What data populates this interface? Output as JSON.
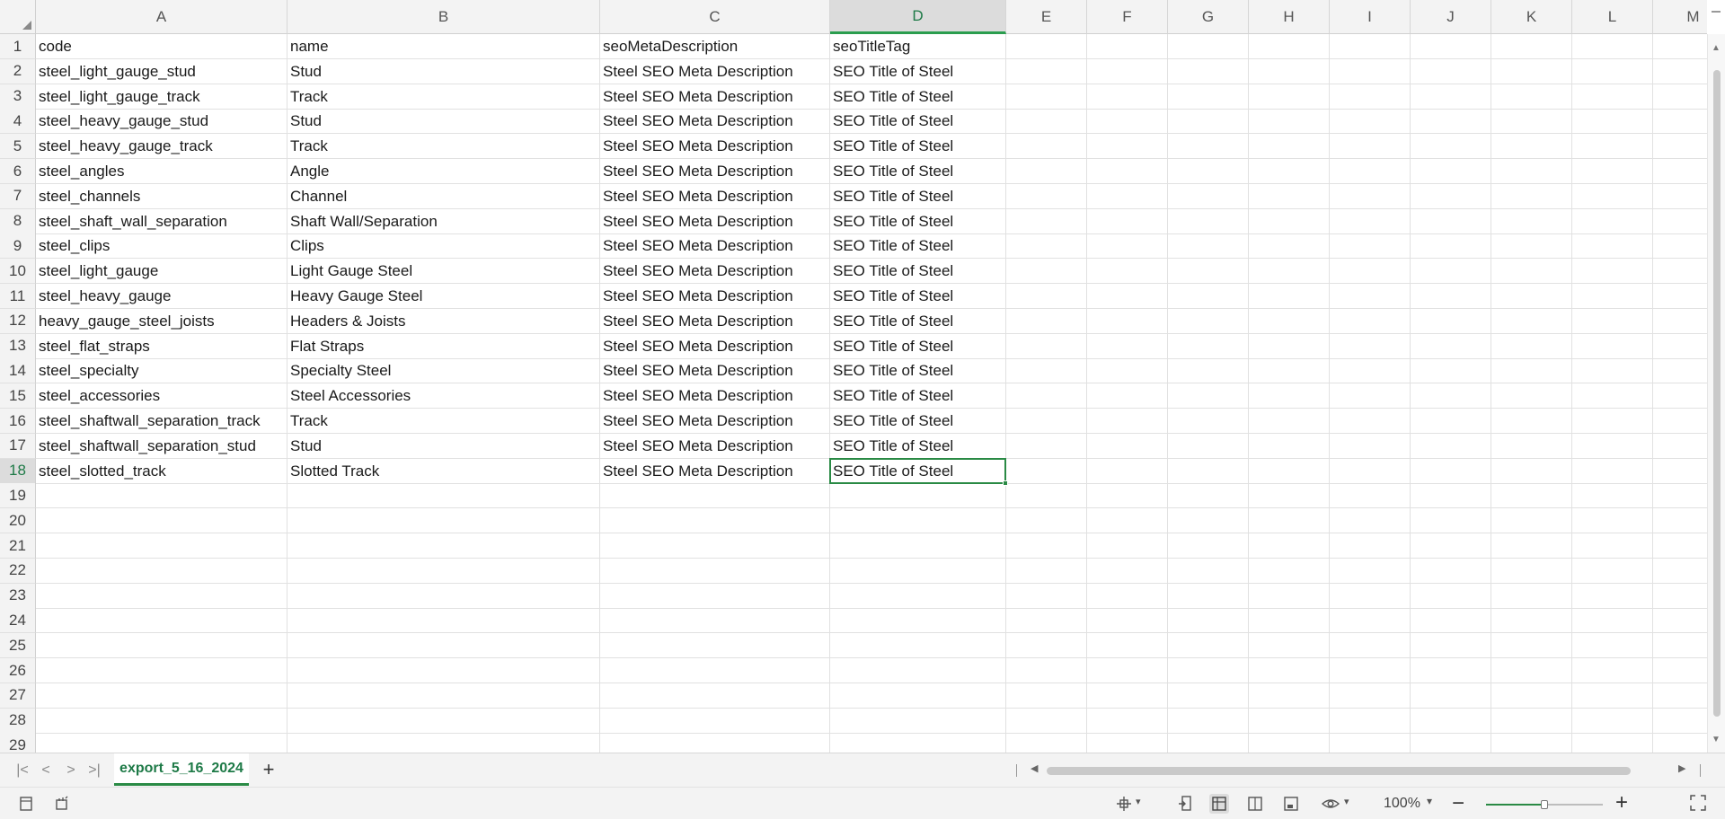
{
  "columns": [
    "A",
    "B",
    "C",
    "D",
    "E",
    "F",
    "G",
    "H",
    "I",
    "J",
    "K",
    "L",
    "M"
  ],
  "selected_column": "D",
  "rows": [
    [
      "code",
      "name",
      "seoMetaDescription",
      "seoTitleTag"
    ],
    [
      "steel_light_gauge_stud",
      "Stud",
      "Steel SEO Meta Description",
      "SEO Title of Steel"
    ],
    [
      "steel_light_gauge_track",
      "Track",
      "Steel SEO Meta Description",
      "SEO Title of Steel"
    ],
    [
      "steel_heavy_gauge_stud",
      "Stud",
      "Steel SEO Meta Description",
      "SEO Title of Steel"
    ],
    [
      "steel_heavy_gauge_track",
      "Track",
      "Steel SEO Meta Description",
      "SEO Title of Steel"
    ],
    [
      "steel_angles",
      "Angle",
      "Steel SEO Meta Description",
      "SEO Title of Steel"
    ],
    [
      "steel_channels",
      "Channel",
      "Steel SEO Meta Description",
      "SEO Title of Steel"
    ],
    [
      "steel_shaft_wall_separation",
      "Shaft Wall/Separation",
      "Steel SEO Meta Description",
      "SEO Title of Steel"
    ],
    [
      "steel_clips",
      "Clips",
      "Steel SEO Meta Description",
      "SEO Title of Steel"
    ],
    [
      "steel_light_gauge",
      "Light Gauge Steel",
      "Steel SEO Meta Description",
      "SEO Title of Steel"
    ],
    [
      "steel_heavy_gauge",
      "Heavy Gauge Steel",
      "Steel SEO Meta Description",
      "SEO Title of Steel"
    ],
    [
      "heavy_gauge_steel_joists",
      "Headers & Joists",
      "Steel SEO Meta Description",
      "SEO Title of Steel"
    ],
    [
      "steel_flat_straps",
      "Flat Straps",
      "Steel SEO Meta Description",
      "SEO Title of Steel"
    ],
    [
      "steel_specialty",
      "Specialty Steel",
      "Steel SEO Meta Description",
      "SEO Title of Steel"
    ],
    [
      "steel_accessories",
      "Steel Accessories",
      "Steel SEO Meta Description",
      "SEO Title of Steel"
    ],
    [
      "steel_shaftwall_separation_track",
      "Track",
      "Steel SEO Meta Description",
      "SEO Title of Steel"
    ],
    [
      "steel_shaftwall_separation_stud",
      "Stud",
      "Steel SEO Meta Description",
      "SEO Title of Steel"
    ],
    [
      "steel_slotted_track",
      "Slotted Track",
      "Steel SEO Meta Description",
      "SEO Title of Steel"
    ]
  ],
  "visible_row_count": 29,
  "active_cell": "D18",
  "sheet_tab": "export_5_16_2024",
  "zoom": {
    "label": "100%",
    "level_fraction": 0.5
  },
  "colors": {
    "accent": "#2a8a45",
    "header_bg": "#f3f3f3",
    "selected_header_bg": "#dcdcdc"
  }
}
